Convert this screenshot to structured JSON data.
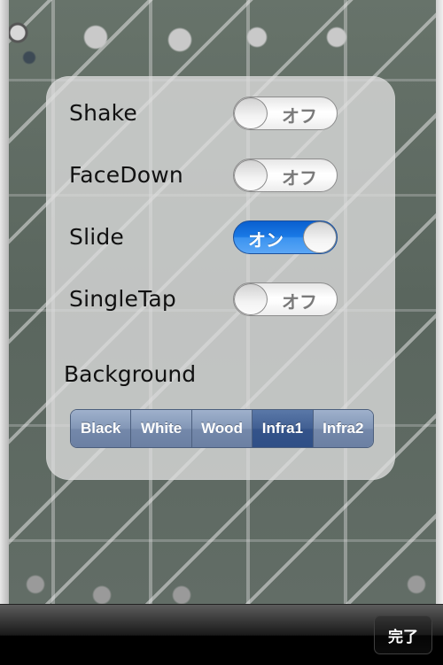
{
  "settings": {
    "toggles": [
      {
        "label": "Shake",
        "state": "off",
        "state_text": "オフ"
      },
      {
        "label": "FaceDown",
        "state": "off",
        "state_text": "オフ"
      },
      {
        "label": "Slide",
        "state": "on",
        "state_text": "オン"
      },
      {
        "label": "SingleTap",
        "state": "off",
        "state_text": "オフ"
      }
    ],
    "background": {
      "label": "Background",
      "options": [
        "Black",
        "White",
        "Wood",
        "Infra1",
        "Infra2"
      ],
      "selected": "Infra1"
    }
  },
  "toolbar": {
    "done_label": "完了"
  },
  "colors": {
    "switch_on": "#1a7ae6",
    "segment": "#8296b6",
    "segment_selected": "#415f92"
  }
}
